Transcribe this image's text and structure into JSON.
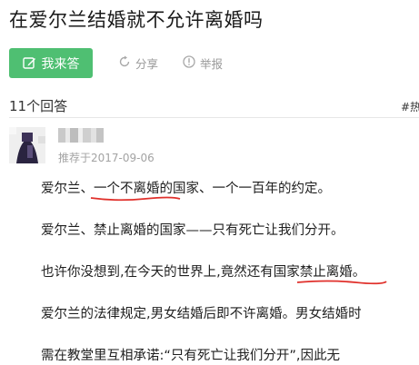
{
  "question": {
    "title": "在爱尔兰结婚就不允许离婚吗"
  },
  "actions": {
    "answer_label": "我来答",
    "share_label": "分享",
    "report_label": "举报"
  },
  "answers": {
    "count_label": "11个回答",
    "hot_label": "#热"
  },
  "answer": {
    "date_label": "推荐于2017-09-06",
    "p1": {
      "a": "爱尔兰、",
      "b": "一个不离婚的国家",
      "c": "、一个一百年的约定。"
    },
    "p2": "爱尔兰、禁止离婚的国家——只有死亡让我们分开。",
    "p3": {
      "a": "也许你没想到,在今天的世界上,竟然还有国家",
      "b": "禁止离婚",
      "c": "。"
    },
    "p4": "爱尔兰的法律规定,男女结婚后即不许离婚。男女结婚时",
    "p5": "需在教堂里互相承诺:“只有死亡让我们分开”,因此无"
  },
  "colors": {
    "accent_green": "#4fbf72",
    "annotation_red": "#e0302b",
    "muted_gray": "#9a9a9a"
  },
  "icons": [
    "edit-icon",
    "share-icon",
    "report-icon"
  ]
}
